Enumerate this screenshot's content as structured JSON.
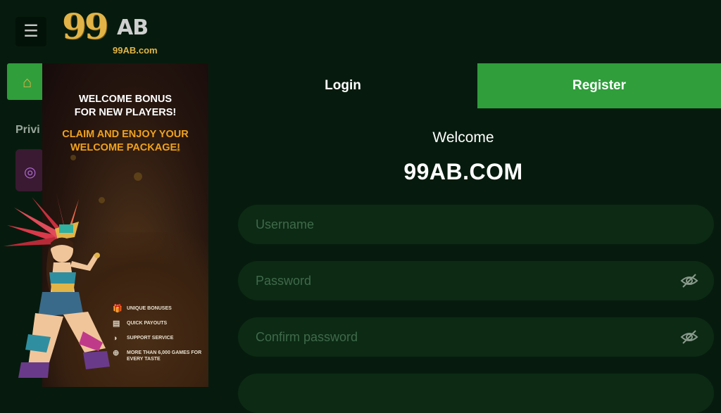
{
  "header": {
    "logo_text": "99AB",
    "logo_domain": "99AB.com",
    "menu_icon": "hamburger-icon"
  },
  "background": {
    "section_label": "Privi"
  },
  "promo": {
    "headline": "WELCOME BONUS FOR NEW PLAYERS!",
    "subheadline": "CLAIM AND ENJOY YOUR WELCOME PACKAGE!",
    "features": [
      {
        "icon": "gift-icon",
        "label": "UNIQUE BONUSES"
      },
      {
        "icon": "wallet-icon",
        "label": "QUICK PAYOUTS"
      },
      {
        "icon": "headset-icon",
        "label": "SUPPORT SERVICE"
      },
      {
        "icon": "gamepad-icon",
        "label": "MORE THAN 6,000 GAMES FOR EVERY TASTE"
      }
    ]
  },
  "auth": {
    "tabs": [
      {
        "label": "Login",
        "active": false
      },
      {
        "label": "Register",
        "active": true
      }
    ],
    "welcome": "Welcome",
    "site_name": "99AB.COM",
    "fields": {
      "username": {
        "placeholder": "Username",
        "value": ""
      },
      "password": {
        "placeholder": "Password",
        "value": ""
      },
      "confirm_password": {
        "placeholder": "Confirm password",
        "value": ""
      }
    }
  },
  "colors": {
    "background": "#061b0d",
    "accent_green": "#2f9e3b",
    "gold": "#e2b447",
    "promo_orange": "#f0a21e"
  }
}
